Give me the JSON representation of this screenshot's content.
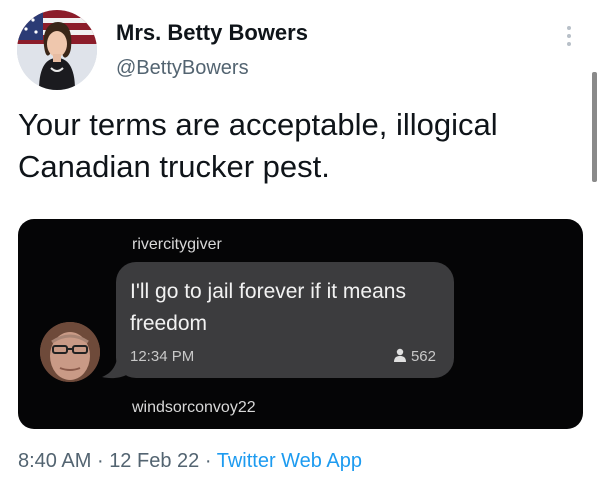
{
  "author": {
    "display_name": "Mrs. Betty Bowers",
    "handle": "@BettyBowers"
  },
  "tweet": {
    "text": "Your terms are acceptable, illogical Canadian trucker pest."
  },
  "chat_screenshot": {
    "sender_top": "rivercitygiver",
    "message": "I'll go to jail forever if it means freedom",
    "time": "12:34 PM",
    "count": "562",
    "sender_bottom": "windsorconvoy22"
  },
  "meta": {
    "time": "8:40 AM",
    "separator": "·",
    "date": "12 Feb 22",
    "app": "Twitter Web App"
  },
  "icons": {
    "more": "more-vertical-icon",
    "person": "person-icon"
  },
  "colors": {
    "link_blue": "#1d9bf0",
    "secondary_text": "#536471",
    "chat_background": "#050506",
    "bubble": "#3c3c3e"
  }
}
